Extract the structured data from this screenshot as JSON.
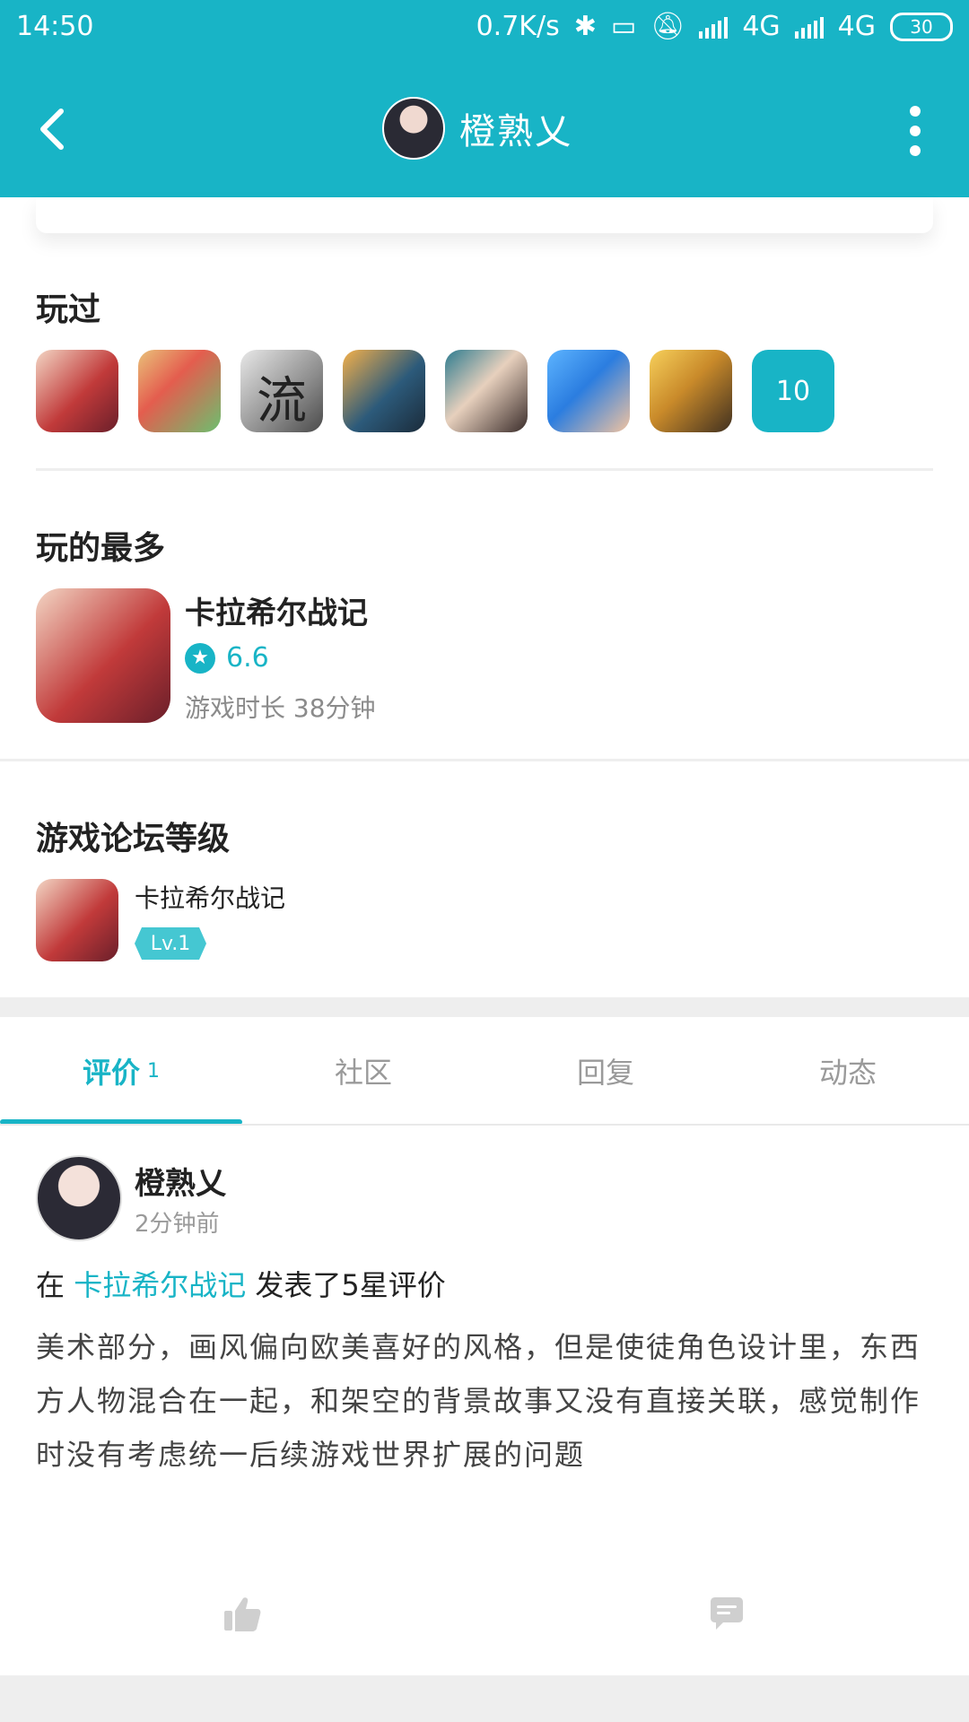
{
  "status_bar": {
    "time": "14:50",
    "net_speed": "0.7K/s",
    "net1": "4G",
    "net2": "4G",
    "battery": "30"
  },
  "header": {
    "title": "橙熟乂"
  },
  "played": {
    "title": "玩过",
    "icons": [
      "game-1-icon",
      "game-2-icon",
      "game-3-icon",
      "game-4-icon",
      "game-5-icon",
      "game-6-icon",
      "game-7-icon"
    ],
    "more_count": "10"
  },
  "most_played": {
    "title": "玩的最多",
    "game_name": "卡拉希尔战记",
    "rating": "6.6",
    "playtime": "游戏时长 38分钟"
  },
  "forum_level": {
    "title": "游戏论坛等级",
    "game_name": "卡拉希尔战记",
    "level": "Lv.1"
  },
  "tabs": {
    "items": [
      {
        "label": "评价",
        "count": "1"
      },
      {
        "label": "社区"
      },
      {
        "label": "回复"
      },
      {
        "label": "动态"
      }
    ]
  },
  "post": {
    "author": "橙熟乂",
    "time": "2分钟前",
    "prefix": "在",
    "game": "卡拉希尔战记",
    "suffix": "发表了5星评价",
    "body": "美术部分，画风偏向欧美喜好的风格，但是使徒角色设计里，东西方人物混合在一起，和架空的背景故事又没有直接关联，感觉制作时没有考虑统一后续游戏世界扩展的问题"
  },
  "colors": {
    "accent": "#18b4c6",
    "band": "#eeeeee"
  }
}
